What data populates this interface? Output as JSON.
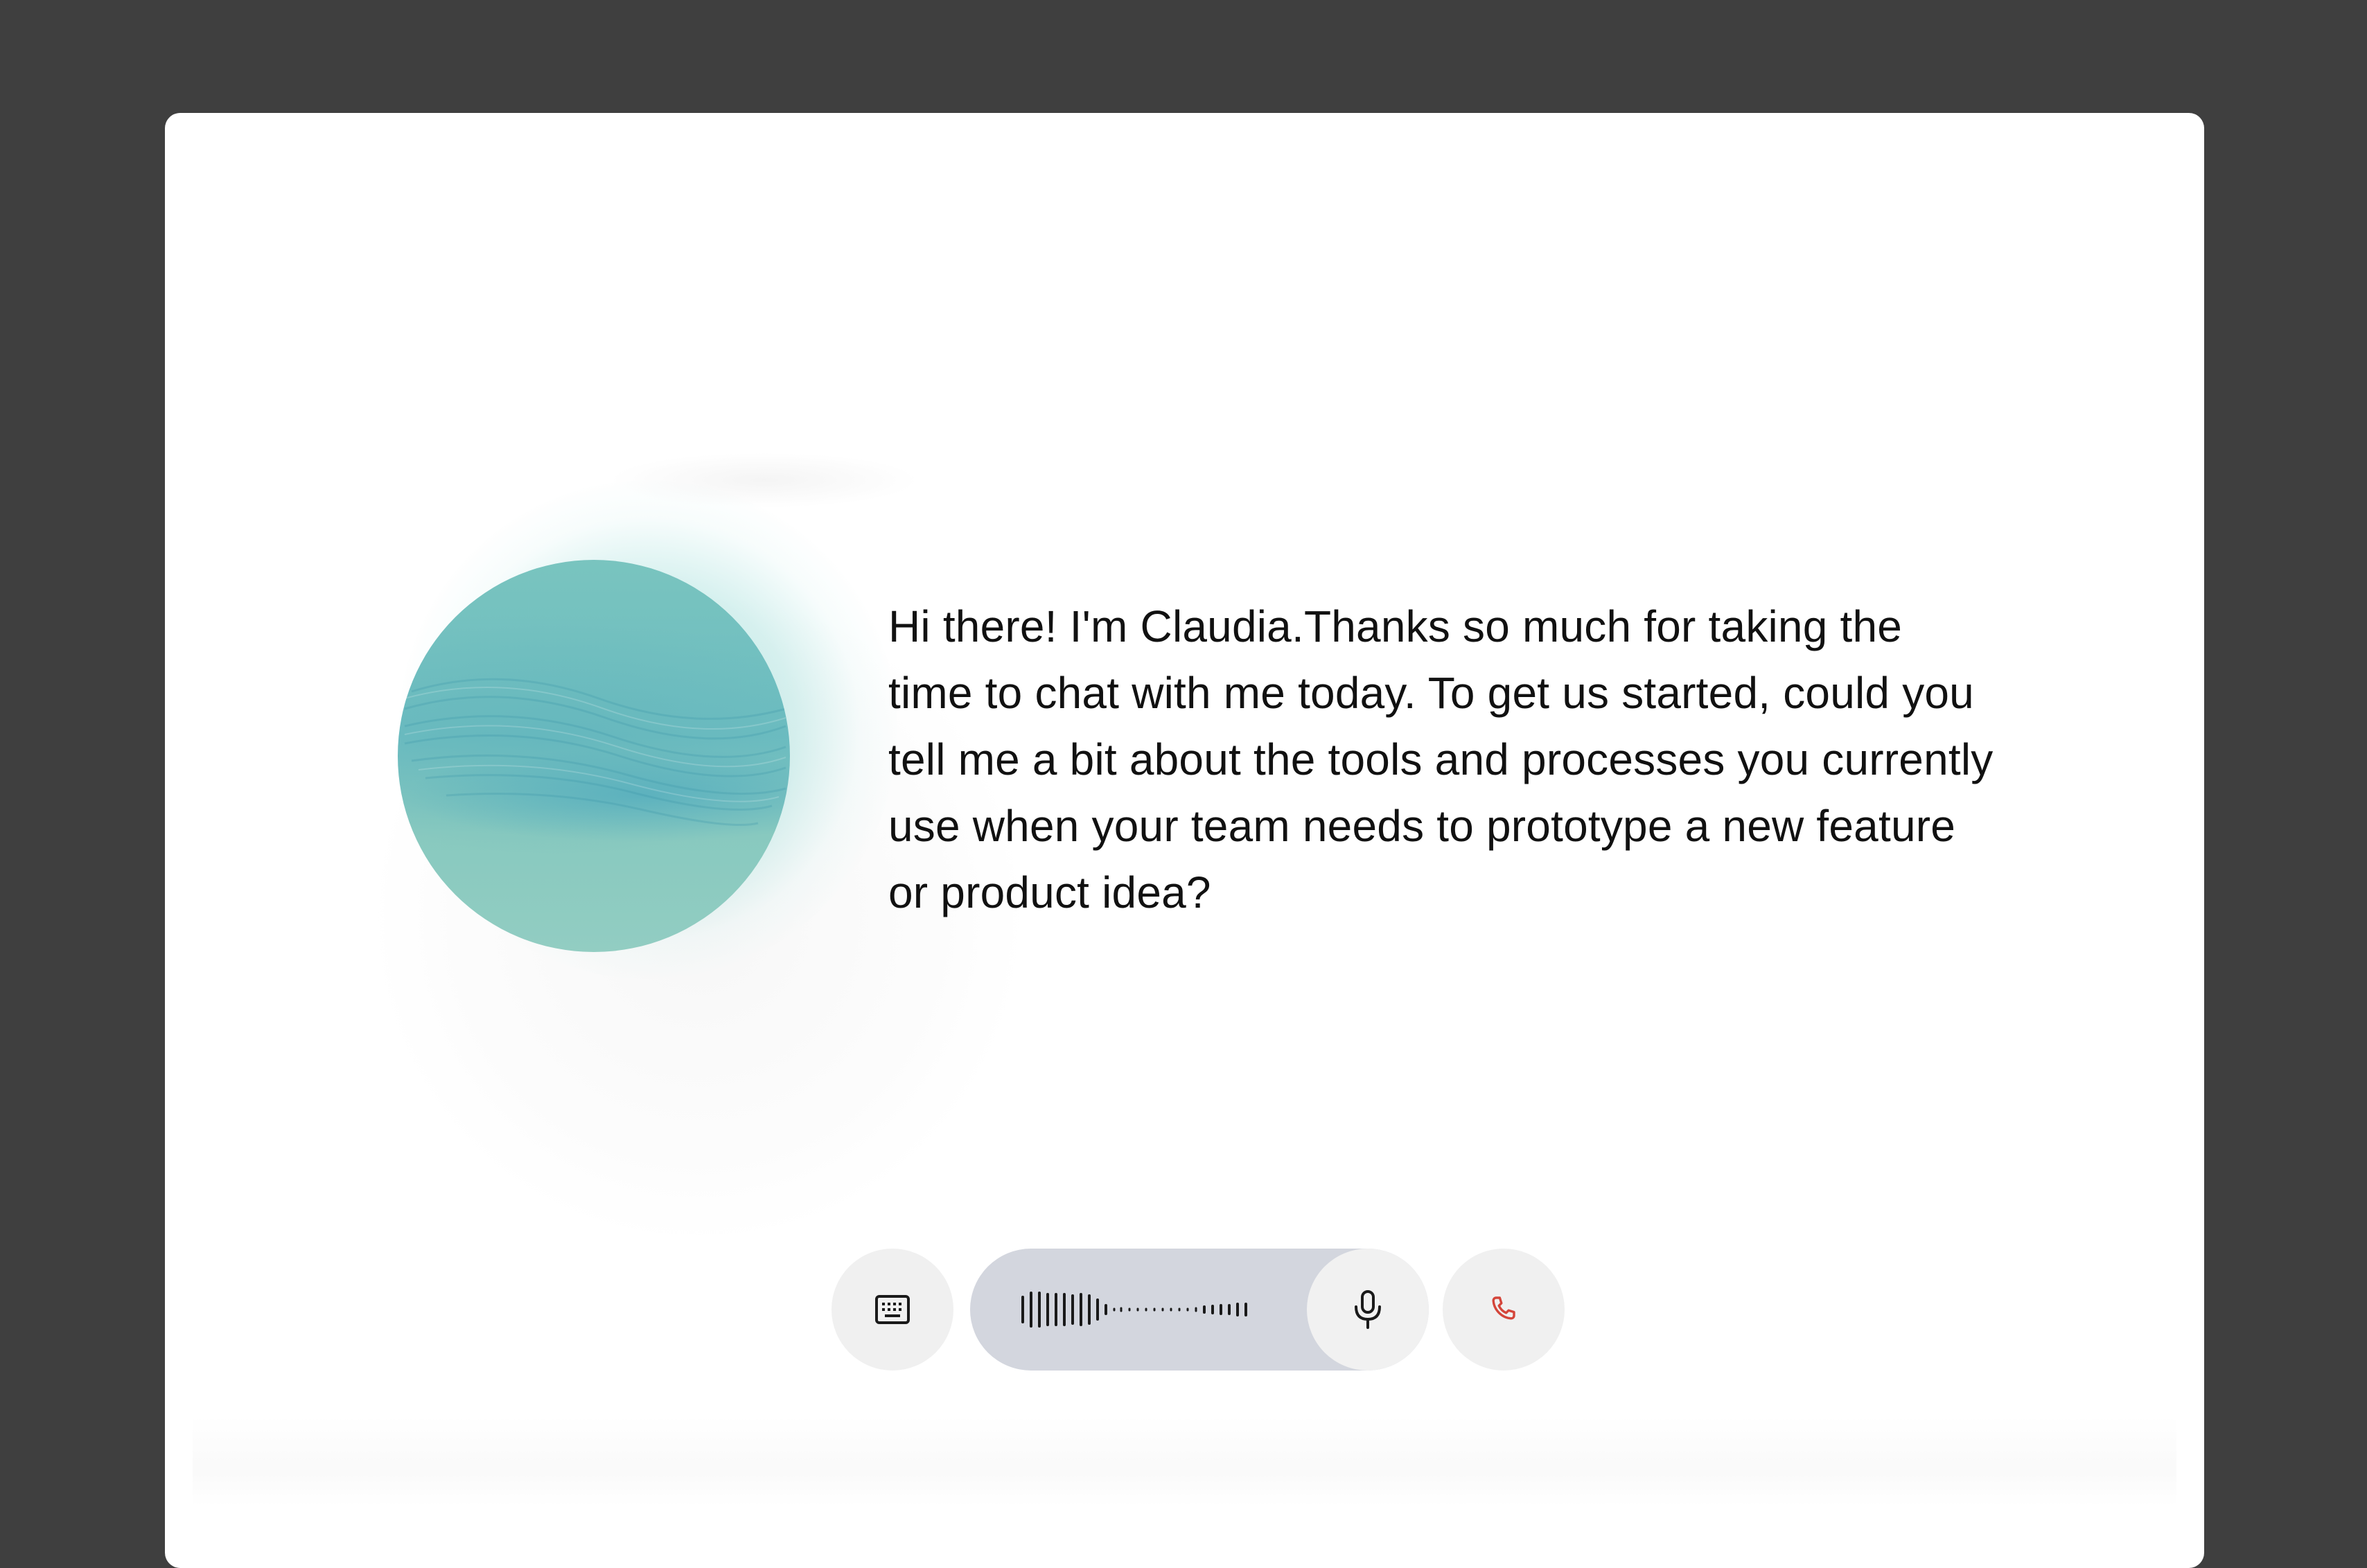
{
  "assistant": {
    "message": "Hi there! I'm Claudia.Thanks so much for taking the time to chat with me today. To get us started, could you tell me a bit about the tools and processes you currently use when your team needs to prototype a new feature or product idea?"
  },
  "controls": {
    "keyboard_icon": "keyboard-icon",
    "waveform_icon": "waveform-icon",
    "mic_icon": "microphone-icon",
    "end_call_icon": "phone-icon",
    "end_call_color": "#d4453a"
  },
  "colors": {
    "backdrop": "#3f3f3f",
    "card": "#ffffff",
    "orb": "#79c4bf",
    "voice_pill": "#d3d6de"
  }
}
